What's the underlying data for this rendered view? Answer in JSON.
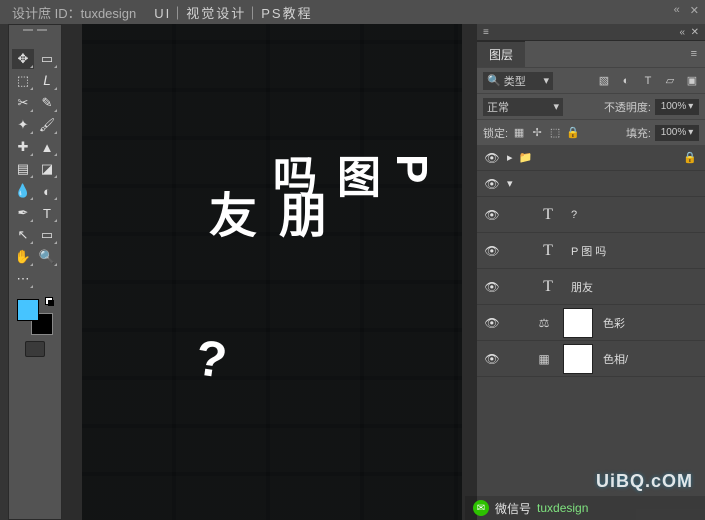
{
  "topbar": {
    "title1": "设计庶 ID：tuxdesign",
    "title2": "UI｜视觉设计｜PS教程"
  },
  "toolbox": {
    "tools": [
      {
        "name": "move-tool",
        "glyph": "✥"
      },
      {
        "name": "artboard-tool",
        "glyph": "▭"
      },
      {
        "name": "marquee-tool",
        "glyph": "⬚"
      },
      {
        "name": "lasso-tool",
        "glyph": "𝘓"
      },
      {
        "name": "crop-tool",
        "glyph": "✂"
      },
      {
        "name": "eyedropper-tool",
        "glyph": "✎"
      },
      {
        "name": "wand-tool",
        "glyph": "✦"
      },
      {
        "name": "brush-tool",
        "glyph": "🖌"
      },
      {
        "name": "healing-tool",
        "glyph": "✚"
      },
      {
        "name": "stamp-tool",
        "glyph": "▲"
      },
      {
        "name": "gradient-tool",
        "glyph": "▤"
      },
      {
        "name": "eraser-tool",
        "glyph": "◪"
      },
      {
        "name": "blur-tool",
        "glyph": "💧"
      },
      {
        "name": "dodge-tool",
        "glyph": "◐"
      },
      {
        "name": "pen-tool",
        "glyph": "✒"
      },
      {
        "name": "type-tool",
        "glyph": "T"
      },
      {
        "name": "path-tool",
        "glyph": "↖"
      },
      {
        "name": "shape-tool",
        "glyph": "▭"
      },
      {
        "name": "hand-tool",
        "glyph": "✋"
      },
      {
        "name": "zoom-tool",
        "glyph": "🔍"
      },
      {
        "name": "edit-toolbar",
        "glyph": "⋯"
      }
    ],
    "foreground_color": "#46c4ff",
    "background_color": "#000000"
  },
  "canvas": {
    "text_col1": "朋友",
    "text_col2": "P 图 吗",
    "text_q": "?"
  },
  "layers_panel": {
    "tab": "图层",
    "filter_label": "类型",
    "filter_icon": "🔍",
    "blend_mode": "正常",
    "opacity_label": "不透明度:",
    "opacity_value": "100%",
    "lock_label": "锁定:",
    "fill_label": "填充:",
    "fill_value": "100%",
    "layers": [
      {
        "kind": "group",
        "vis": true,
        "name": "",
        "locked": true
      },
      {
        "kind": "spacer",
        "vis": true
      },
      {
        "kind": "text",
        "vis": true,
        "name": "?"
      },
      {
        "kind": "text",
        "vis": true,
        "name": "P 图 吗"
      },
      {
        "kind": "text",
        "vis": true,
        "name": "朋友"
      },
      {
        "kind": "adj",
        "vis": true,
        "name": "色彩",
        "adj_icon": "⚖"
      },
      {
        "kind": "adj",
        "vis": true,
        "name": "色相/",
        "adj_icon": "▦"
      }
    ]
  },
  "footer": {
    "label": "微信号",
    "handle": "tuxdesign"
  },
  "watermark": "UiBQ.cOM"
}
